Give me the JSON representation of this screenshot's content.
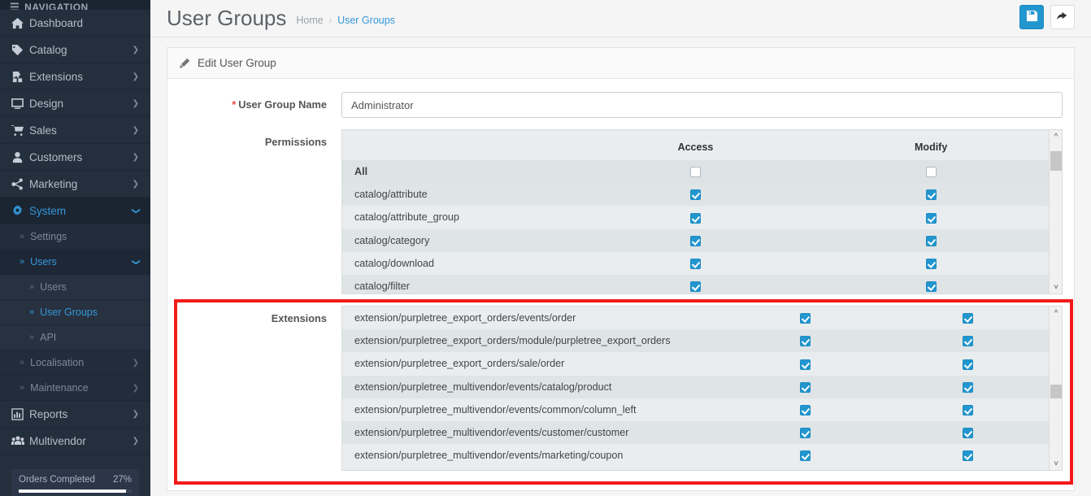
{
  "sidebar": {
    "header": "NAVIGATION",
    "items": [
      {
        "label": "Dashboard",
        "icon": "home-icon",
        "caret": "",
        "active": false
      },
      {
        "label": "Catalog",
        "icon": "tag-icon",
        "caret": "❯",
        "active": false
      },
      {
        "label": "Extensions",
        "icon": "puzzle-icon",
        "caret": "❯",
        "active": false
      },
      {
        "label": "Design",
        "icon": "monitor-icon",
        "caret": "❯",
        "active": false
      },
      {
        "label": "Sales",
        "icon": "cart-icon",
        "caret": "❯",
        "active": false
      },
      {
        "label": "Customers",
        "icon": "user-icon",
        "caret": "❯",
        "active": false
      },
      {
        "label": "Marketing",
        "icon": "share-icon",
        "caret": "❯",
        "active": false
      },
      {
        "label": "System",
        "icon": "gear-icon",
        "caret": "❯",
        "active": true
      }
    ],
    "system_children": [
      {
        "label": "Settings",
        "caret": "",
        "active": false,
        "level": 2
      },
      {
        "label": "Users",
        "caret": "❯",
        "active": true,
        "level": 2
      },
      {
        "label": "Users",
        "caret": "",
        "active": false,
        "level": 3
      },
      {
        "label": "User Groups",
        "caret": "",
        "active": true,
        "level": 3
      },
      {
        "label": "API",
        "caret": "",
        "active": false,
        "level": 3
      },
      {
        "label": "Localisation",
        "caret": "❯",
        "active": false,
        "level": 2
      },
      {
        "label": "Maintenance",
        "caret": "❯",
        "active": false,
        "level": 2
      }
    ],
    "items_after": [
      {
        "label": "Reports",
        "icon": "chart-icon",
        "caret": "❯",
        "active": false
      },
      {
        "label": "Multivendor",
        "icon": "users-icon",
        "caret": "❯",
        "active": false
      }
    ],
    "progress": {
      "label": "Orders Completed",
      "percent_label": "27%",
      "percent": 95
    },
    "chevron_glyph": "»"
  },
  "header": {
    "title": "User Groups",
    "breadcrumb": [
      {
        "label": "Home",
        "link": false
      },
      {
        "label": "User Groups",
        "link": true
      }
    ],
    "separator": "›",
    "save_label": "save-icon",
    "back_label": "back-icon"
  },
  "panel": {
    "title": "Edit User Group",
    "form": {
      "name_label": "User Group Name",
      "name_required": "*",
      "name_value": "Administrator",
      "name_placeholder": "User Group Name"
    },
    "permissions": {
      "label": "Permissions",
      "columns": [
        "",
        "Access",
        "Modify"
      ],
      "rows": [
        {
          "label": "All",
          "access": false,
          "modify": false,
          "is_all": true
        },
        {
          "label": "catalog/attribute",
          "access": true,
          "modify": true
        },
        {
          "label": "catalog/attribute_group",
          "access": true,
          "modify": true
        },
        {
          "label": "catalog/category",
          "access": true,
          "modify": true
        },
        {
          "label": "catalog/download",
          "access": true,
          "modify": true
        },
        {
          "label": "catalog/filter",
          "access": true,
          "modify": true
        }
      ],
      "scroll_thumb_top_pct": 6,
      "scroll_thumb_height_pct": 14
    },
    "extensions": {
      "label": "Extensions",
      "rows": [
        {
          "label": "extension/purpletree_export_orders/events/order",
          "access": true,
          "modify": true
        },
        {
          "label": "extension/purpletree_export_orders/module/purpletree_export_orders",
          "access": true,
          "modify": true
        },
        {
          "label": "extension/purpletree_export_orders/sale/order",
          "access": true,
          "modify": true
        },
        {
          "label": "extension/purpletree_multivendor/events/catalog/product",
          "access": true,
          "modify": true
        },
        {
          "label": "extension/purpletree_multivendor/events/common/column_left",
          "access": true,
          "modify": true
        },
        {
          "label": "extension/purpletree_multivendor/events/customer/customer",
          "access": true,
          "modify": true
        },
        {
          "label": "extension/purpletree_multivendor/events/marketing/coupon",
          "access": true,
          "modify": true
        }
      ],
      "scroll_thumb_top_pct": 47,
      "scroll_thumb_height_pct": 10,
      "highlight_color": "#f41a1a"
    }
  },
  "colors": {
    "accent": "#3498db",
    "sidebar_bg": "#242f3e",
    "checkbox_on": "#2196cf",
    "highlight": "#f41a1a",
    "required": "#e74c3c"
  }
}
